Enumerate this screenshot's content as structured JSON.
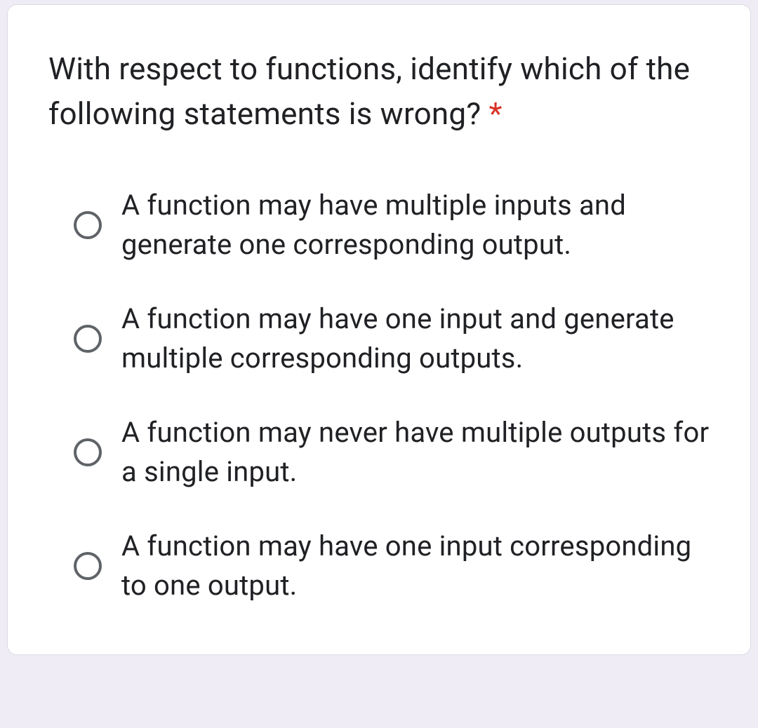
{
  "question": {
    "text": "With respect to functions, identify which of the following statements is wrong?",
    "required_marker": " *"
  },
  "options": [
    {
      "label": "A function may have multiple inputs and generate one corresponding output."
    },
    {
      "label": "A function may have one input and generate multiple corresponding outputs."
    },
    {
      "label": "A function may never have multiple outputs for a single input."
    },
    {
      "label": "A function may have one input corresponding to one output."
    }
  ]
}
